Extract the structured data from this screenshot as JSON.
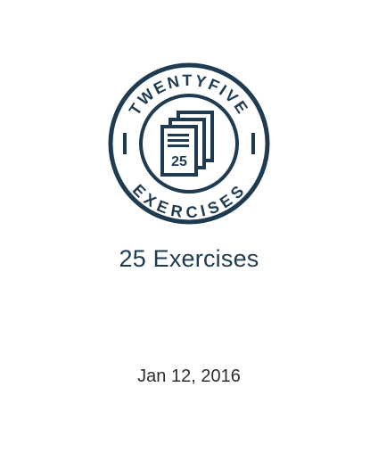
{
  "badge": {
    "icon": "twentyfive-exercises-badge-icon",
    "ring_top_text": "TWENTYFIVE",
    "ring_bottom_text": "EXERCISES",
    "center_number": "25",
    "color": "#1e3b52"
  },
  "item": {
    "title": "25 Exercises",
    "date": "Jan 12, 2016"
  }
}
